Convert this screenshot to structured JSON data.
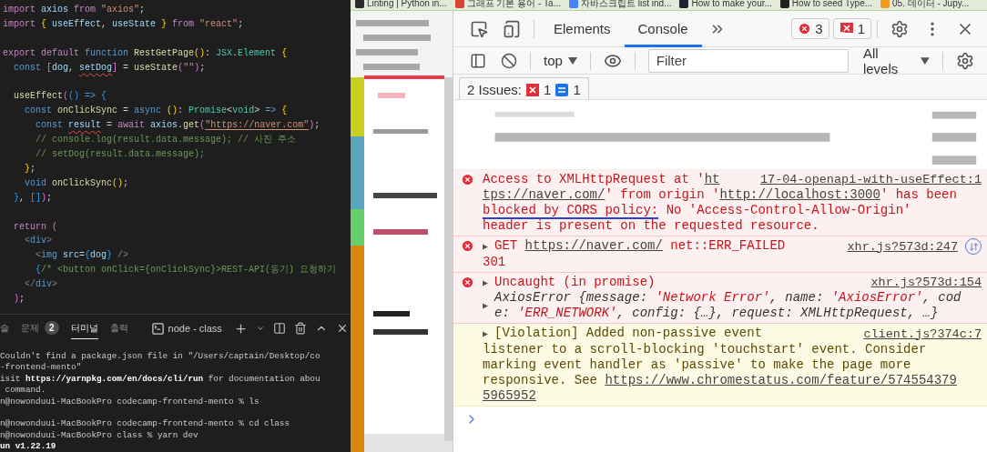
{
  "bookmarks": [
    {
      "label": "Linting | Python in...",
      "color": "#2b2b2b"
    },
    {
      "label": "그래프 기본 용어 - Ta...",
      "color": "#d9432f"
    },
    {
      "label": "자바스크립트 list ind...",
      "color": "#4285f4"
    },
    {
      "label": "How to make your...",
      "color": "#1b2233"
    },
    {
      "label": "How to seed Type...",
      "color": "#222222"
    },
    {
      "label": "05. 데이터 - Jupy...",
      "color": "#f09a1a"
    }
  ],
  "editor": {
    "lines": [
      {
        "tokens": [
          {
            "kind": "kw",
            "t": "import "
          },
          {
            "kind": "var",
            "t": "axios "
          },
          {
            "kind": "kw",
            "t": "from "
          },
          {
            "kind": "str",
            "t": "\"axios\""
          },
          {
            "kind": "p",
            "t": ";"
          }
        ]
      },
      {
        "tokens": [
          {
            "kind": "kw",
            "t": "import "
          },
          {
            "kind": "b1",
            "t": "{"
          },
          {
            "kind": "var",
            "t": " useEffect"
          },
          {
            "kind": "p",
            "t": ", "
          },
          {
            "kind": "var",
            "t": "useState "
          },
          {
            "kind": "b1",
            "t": "}"
          },
          {
            "kind": "kw",
            "t": " from "
          },
          {
            "kind": "str",
            "t": "\"react\""
          },
          {
            "kind": "p",
            "t": ";"
          }
        ]
      },
      {
        "kind": "blank"
      },
      {
        "tokens": [
          {
            "kind": "kw",
            "t": "export default "
          },
          {
            "kind": "st",
            "t": "function "
          },
          {
            "kind": "fn",
            "t": "RestGetPage"
          },
          {
            "kind": "b1",
            "t": "()"
          },
          {
            "kind": "p",
            "t": ": "
          },
          {
            "kind": "type",
            "t": "JSX"
          },
          {
            "kind": "p",
            "t": "."
          },
          {
            "kind": "type",
            "t": "Element "
          },
          {
            "kind": "b1",
            "t": "{"
          }
        ]
      },
      {
        "tokens": [
          {
            "kind": "st",
            "t": "  const "
          },
          {
            "kind": "b2",
            "t": "["
          },
          {
            "kind": "var",
            "t": "dog"
          },
          {
            "kind": "p",
            "t": ", "
          },
          {
            "kind": "err",
            "t": "setDog"
          },
          {
            "kind": "b2",
            "t": "]"
          },
          {
            "kind": "p",
            "t": " = "
          },
          {
            "kind": "fn",
            "t": "useState"
          },
          {
            "kind": "b2",
            "t": "("
          },
          {
            "kind": "str",
            "t": "\"\""
          },
          {
            "kind": "b2",
            "t": ")"
          },
          {
            "kind": "p",
            "t": ";"
          }
        ]
      },
      {
        "kind": "blank"
      },
      {
        "tokens": [
          {
            "kind": "fn",
            "t": "  useEffect"
          },
          {
            "kind": "b2",
            "t": "("
          },
          {
            "kind": "b3",
            "t": "()"
          },
          {
            "kind": "st",
            "t": " => "
          },
          {
            "kind": "b3",
            "t": "{"
          }
        ]
      },
      {
        "tokens": [
          {
            "kind": "st",
            "t": "    const "
          },
          {
            "kind": "fn",
            "t": "onClickSync"
          },
          {
            "kind": "p",
            "t": " = "
          },
          {
            "kind": "st",
            "t": "async "
          },
          {
            "kind": "b1",
            "t": "()"
          },
          {
            "kind": "p",
            "t": ": "
          },
          {
            "kind": "type",
            "t": "Promise"
          },
          {
            "kind": "p",
            "t": "<"
          },
          {
            "kind": "type",
            "t": "void"
          },
          {
            "kind": "p",
            "t": "> "
          },
          {
            "kind": "st",
            "t": "=> "
          },
          {
            "kind": "b1",
            "t": "{"
          }
        ]
      },
      {
        "tokens": [
          {
            "kind": "st",
            "t": "      const "
          },
          {
            "kind": "err",
            "t": "result"
          },
          {
            "kind": "p",
            "t": " = "
          },
          {
            "kind": "kw",
            "t": "await "
          },
          {
            "kind": "var",
            "t": "axios"
          },
          {
            "kind": "p",
            "t": "."
          },
          {
            "kind": "fn",
            "t": "get"
          },
          {
            "kind": "b2",
            "t": "("
          },
          {
            "kind": "url",
            "t": "\"https://naver.com\""
          },
          {
            "kind": "b2",
            "t": ")"
          },
          {
            "kind": "p",
            "t": ";"
          }
        ]
      },
      {
        "tokens": [
          {
            "kind": "cm",
            "t": "      // console.log(result.data.message); // 사진 주소"
          }
        ]
      },
      {
        "tokens": [
          {
            "kind": "cm",
            "t": "      // setDog(result.data.message);"
          }
        ]
      },
      {
        "tokens": [
          {
            "kind": "b1",
            "t": "    }"
          },
          {
            "kind": "p",
            "t": ";"
          }
        ]
      },
      {
        "tokens": [
          {
            "kind": "st",
            "t": "    void "
          },
          {
            "kind": "fn",
            "t": "onClickSync"
          },
          {
            "kind": "b1",
            "t": "()"
          },
          {
            "kind": "p",
            "t": ";"
          }
        ]
      },
      {
        "tokens": [
          {
            "kind": "b3",
            "t": "  }"
          },
          {
            "kind": "p",
            "t": ", "
          },
          {
            "kind": "b3",
            "t": "[]"
          },
          {
            "kind": "b2",
            "t": ")"
          },
          {
            "kind": "p",
            "t": ";"
          }
        ]
      },
      {
        "kind": "blank"
      },
      {
        "tokens": [
          {
            "kind": "kw",
            "t": "  return "
          },
          {
            "kind": "b2",
            "t": "("
          }
        ]
      },
      {
        "tokens": [
          {
            "kind": "tag",
            "t": "    <"
          },
          {
            "kind": "tn",
            "t": "div"
          },
          {
            "kind": "tag",
            "t": ">"
          }
        ]
      },
      {
        "tokens": [
          {
            "kind": "tag",
            "t": "      <"
          },
          {
            "kind": "tn",
            "t": "img "
          },
          {
            "kind": "var",
            "t": "src"
          },
          {
            "kind": "p",
            "t": "="
          },
          {
            "kind": "b3",
            "t": "{"
          },
          {
            "kind": "var",
            "t": "dog"
          },
          {
            "kind": "b3",
            "t": "}"
          },
          {
            "kind": "tag",
            "t": " />"
          }
        ]
      },
      {
        "tokens": [
          {
            "kind": "b3",
            "t": "      {"
          },
          {
            "kind": "cm",
            "t": "/* <button onClick={onClickSync}>REST-API(동기) 요청하기"
          }
        ]
      },
      {
        "tokens": [
          {
            "kind": "tag",
            "t": "    </"
          },
          {
            "kind": "tn",
            "t": "div"
          },
          {
            "kind": "tag",
            "t": ">"
          }
        ]
      },
      {
        "tokens": [
          {
            "kind": "b2",
            "t": "  )"
          },
          {
            "kind": "p",
            "t": ";"
          }
        ]
      }
    ]
  },
  "terminal": {
    "tabs": [
      {
        "label": "술",
        "selected": false
      },
      {
        "label": "문제",
        "badge": "2",
        "selected": false
      },
      {
        "label": "터미널",
        "selected": true
      },
      {
        "label": "출력",
        "selected": false
      }
    ],
    "shell": "node - class",
    "lines": [
      {
        "text": "Couldn't find a package.json file in \"/Users/captain/Desktop/co"
      },
      {
        "text": "-frontend-mento\""
      },
      {
        "text": "isit **https://yarnpkg.com/en/docs/cli/run** for documentation abou"
      },
      {
        "text": " command."
      },
      {
        "text": "n@nowonduui-MacBookPro codecamp-frontend-mento % ls"
      },
      {
        "kind": "blank"
      },
      {
        "text": "n@nowonduui-MacBookPro codecamp-frontend-mento % cd class"
      },
      {
        "text": "n@nowonduui-MacBookPro class % yarn dev"
      },
      {
        "text": "**un v1.22.19**"
      }
    ]
  },
  "devtools": {
    "tabs": [
      {
        "label": "Elements",
        "selected": false
      },
      {
        "label": "Console",
        "selected": true
      }
    ],
    "error_count": "3",
    "issue_count": "1",
    "context": "top",
    "filter": {
      "placeholder": "Filter"
    },
    "levels": "All levels",
    "issues": {
      "label": "2 Issues:",
      "errors": "1",
      "info": "1"
    },
    "messages": [
      {
        "kind": "blurred"
      },
      {
        "kind": "error",
        "network_request": false,
        "source": "17-04-openapi-with-useEffect:1",
        "blocks": [
          {
            "lines": [
              [
                {
                  "kind": "text",
                  "t": "Access to XMLHttpRequest at '"
                },
                {
                  "kind": "link",
                  "t": "ht"
                }
              ],
              [
                {
                  "kind": "link",
                  "t": "tps://naver.com/"
                },
                {
                  "kind": "text",
                  "t": "' from origin '"
                },
                {
                  "kind": "link",
                  "t": "http://localhost:3000"
                },
                {
                  "kind": "text",
                  "t": "' has been"
                }
              ],
              [
                {
                  "kind": "text",
                  "t": "blocked by CORS policy:",
                  "marked": true
                },
                {
                  "kind": "text",
                  "t": " No 'Access-Control-Allow-Origin'"
                }
              ],
              [
                {
                  "kind": "text",
                  "t": "header is present on the requested resource."
                }
              ]
            ]
          }
        ]
      },
      {
        "kind": "error",
        "network_request": true,
        "source": "xhr.js?573d:247",
        "blocks": [
          {
            "lines": [
              [
                {
                  "kind": "toggle",
                  "t": "▶"
                },
                {
                  "kind": "text",
                  "t": "GET "
                },
                {
                  "kind": "link",
                  "t": "https://naver.com/"
                },
                {
                  "kind": "text",
                  "t": " net::ERR_FAILED"
                }
              ],
              [
                {
                  "kind": "text",
                  "t": "301"
                }
              ]
            ]
          }
        ]
      },
      {
        "kind": "error",
        "network_request": false,
        "source": "xhr.js?573d:154",
        "blocks": [
          {
            "toggle": "▶",
            "lines": [
              [
                {
                  "kind": "text",
                  "t": "Uncaught (in promise)"
                }
              ]
            ]
          },
          {
            "toggle": "▶",
            "lines": [
              [
                {
                  "kind": "obj",
                  "t": "AxiosError {message: "
                },
                {
                  "kind": "val",
                  "t": "'Network Error'"
                },
                {
                  "kind": "obj",
                  "t": ", name: "
                },
                {
                  "kind": "val",
                  "t": "'AxiosError'"
                },
                {
                  "kind": "obj",
                  "t": ", cod"
                }
              ],
              [
                {
                  "kind": "obj",
                  "t": "e: "
                },
                {
                  "kind": "val",
                  "t": "'ERR_NETWORK'"
                },
                {
                  "kind": "obj",
                  "t": ", config: {…}, request: XMLHttpRequest, …}"
                }
              ]
            ]
          }
        ]
      },
      {
        "kind": "warning",
        "network_request": false,
        "source": "client.js?374c:7",
        "blocks": [
          {
            "lines": [
              [
                {
                  "kind": "toggle",
                  "t": "▶"
                },
                {
                  "kind": "text",
                  "t": "[Violation] Added non-passive event"
                }
              ],
              [
                {
                  "kind": "text",
                  "t": "listener to a scroll-blocking 'touchstart' event. Consider"
                }
              ],
              [
                {
                  "kind": "text",
                  "t": "marking event handler as 'passive' to make the page more"
                }
              ],
              [
                {
                  "kind": "text",
                  "t": "responsive. See "
                },
                {
                  "kind": "link",
                  "t": "https://www.chromestatus.com/feature/574554379"
                }
              ],
              [
                {
                  "kind": "link",
                  "t": "5965952"
                }
              ]
            ]
          }
        ]
      }
    ]
  }
}
